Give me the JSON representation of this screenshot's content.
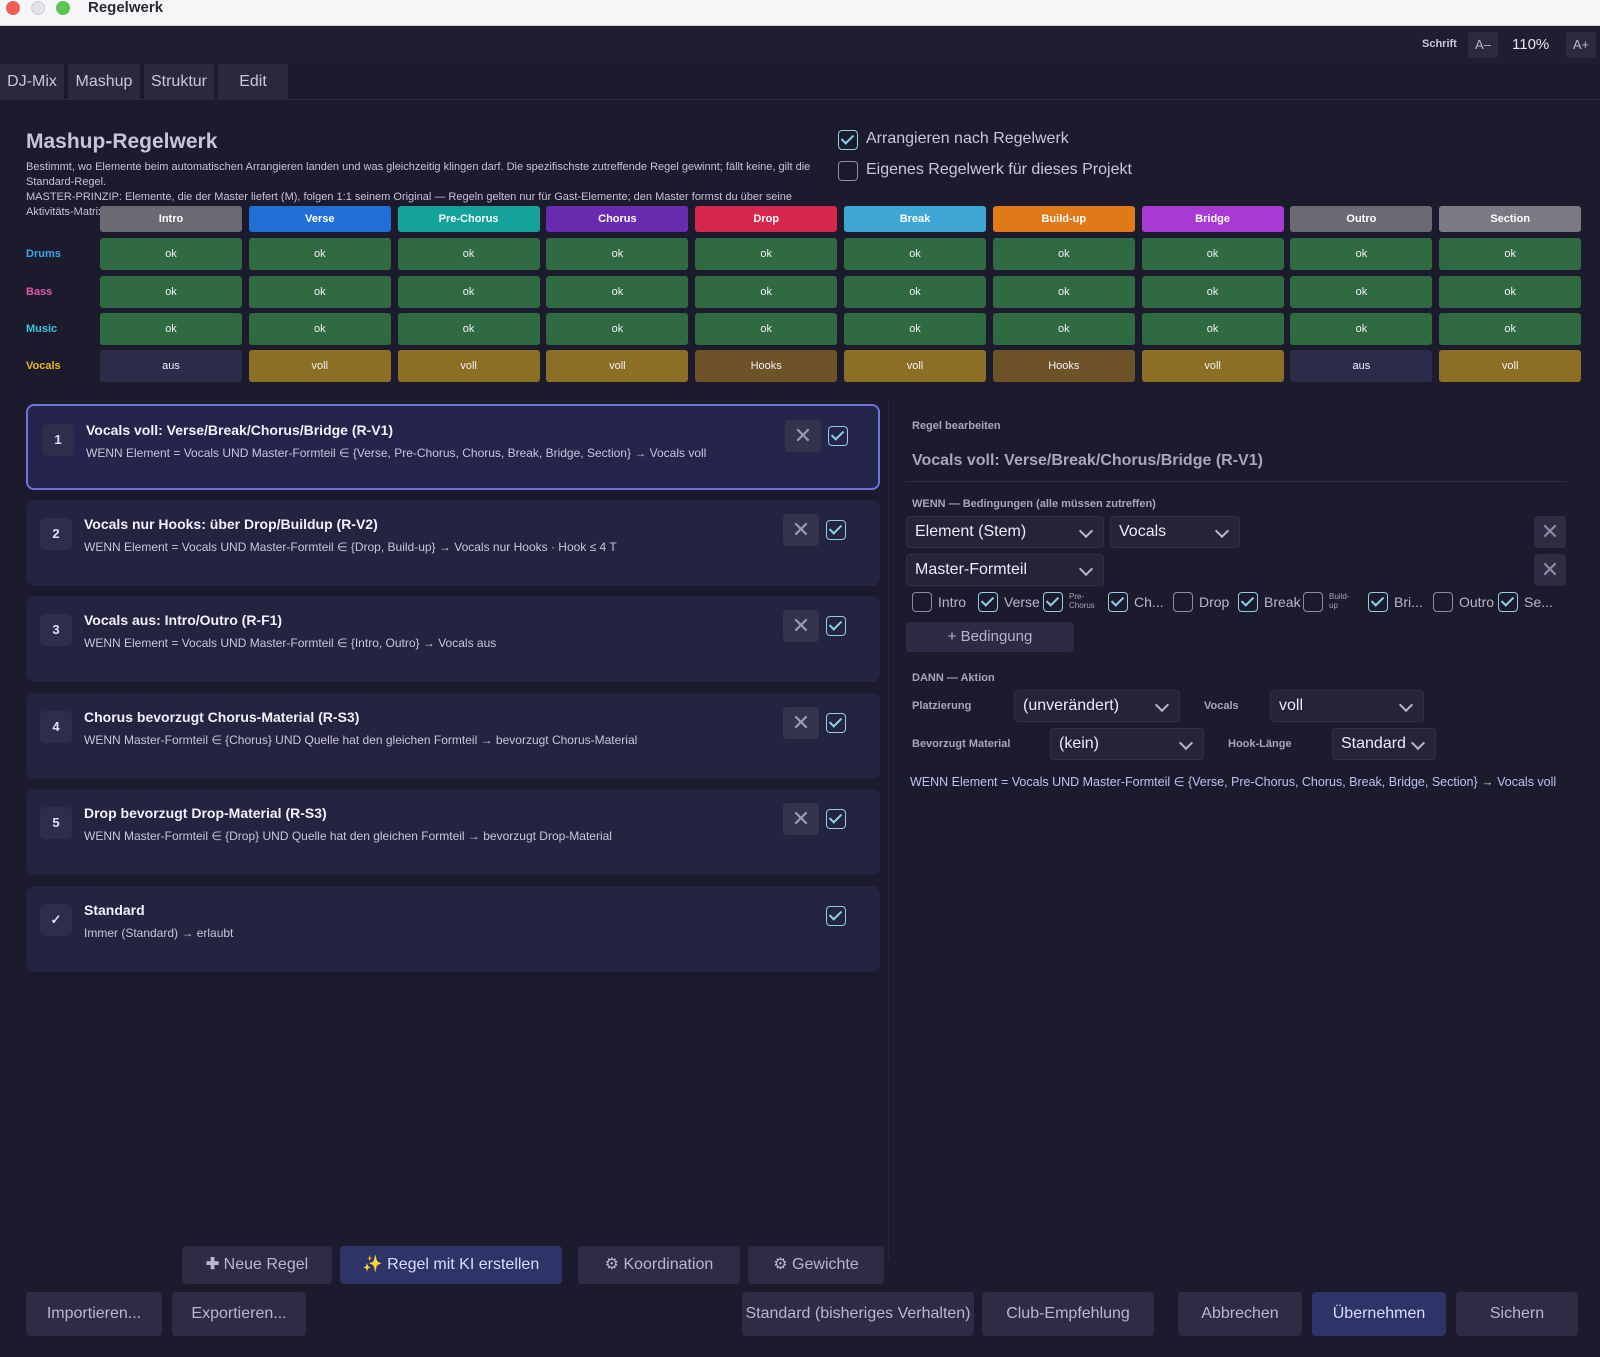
{
  "window": {
    "title": "Regelwerk"
  },
  "toolbar": {
    "font_label": "Schrift",
    "font_down": "A–",
    "zoom": "110%",
    "font_up": "A+"
  },
  "tabs": [
    {
      "label": "DJ-Mix"
    },
    {
      "label": "Mashup"
    },
    {
      "label": "Struktur"
    },
    {
      "label": "Edit"
    }
  ],
  "header": {
    "title": "Mashup-Regelwerk",
    "desc_line1": "Bestimmt, wo Elemente beim automatischen Arrangieren landen und was gleichzeitig klingen darf. Die spezifischste zutreffende Regel gewinnt; fällt keine, gilt die Standard-Regel.",
    "desc_line2": "MASTER-PRINZIP: Elemente, die der Master liefert (M), folgen 1:1 seinem Original — Regeln gelten nur für Gast-Elemente; den Master formst du über seine Aktivitäts-Matrix.",
    "opt_arrange": "Arrangieren nach Regelwerk",
    "opt_arrange_checked": true,
    "opt_own": "Eigenes Regelwerk für dieses Projekt",
    "opt_own_checked": false
  },
  "matrix": {
    "columns": [
      {
        "label": "Intro",
        "color": "#6a6a72"
      },
      {
        "label": "Verse",
        "color": "#1f6fd6"
      },
      {
        "label": "Pre-Chorus",
        "color": "#13a39a"
      },
      {
        "label": "Chorus",
        "color": "#6a2bb0"
      },
      {
        "label": "Drop",
        "color": "#d8274c"
      },
      {
        "label": "Break",
        "color": "#3fa7d6"
      },
      {
        "label": "Build-up",
        "color": "#e07a18"
      },
      {
        "label": "Bridge",
        "color": "#a83ad2"
      },
      {
        "label": "Outro",
        "color": "#6a6a72"
      },
      {
        "label": "Section",
        "color": "#7a7a82"
      }
    ],
    "rows": [
      {
        "label": "Drums",
        "color": "#3aa7e8",
        "cells": [
          "ok",
          "ok",
          "ok",
          "ok",
          "ok",
          "ok",
          "ok",
          "ok",
          "ok",
          "ok"
        ]
      },
      {
        "label": "Bass",
        "color": "#e05aa8",
        "cells": [
          "ok",
          "ok",
          "ok",
          "ok",
          "ok",
          "ok",
          "ok",
          "ok",
          "ok",
          "ok"
        ]
      },
      {
        "label": "Music",
        "color": "#3ac6d8",
        "cells": [
          "ok",
          "ok",
          "ok",
          "ok",
          "ok",
          "ok",
          "ok",
          "ok",
          "ok",
          "ok"
        ]
      },
      {
        "label": "Vocals",
        "color": "#e8b820",
        "cells": [
          "aus",
          "voll",
          "voll",
          "voll",
          "Hooks",
          "voll",
          "Hooks",
          "voll",
          "aus",
          "voll"
        ]
      }
    ]
  },
  "rules": [
    {
      "num": "1",
      "title": "Vocals voll: Verse/Break/Chorus/Bridge (R-V1)",
      "desc": "WENN Element = Vocals UND Master-Formteil ∈ {Verse, Pre-Chorus, Chorus, Break, Bridge, Section}  →  Vocals voll",
      "delete": "✕"
    },
    {
      "num": "2",
      "title": "Vocals nur Hooks: über Drop/Buildup (R-V2)",
      "desc": "WENN Element = Vocals UND Master-Formteil ∈ {Drop, Build-up}  →  Vocals nur Hooks · Hook ≤ 4 T",
      "delete": "✕"
    },
    {
      "num": "3",
      "title": "Vocals aus: Intro/Outro (R-F1)",
      "desc": "WENN Element = Vocals UND Master-Formteil ∈ {Intro, Outro}  →  Vocals aus",
      "delete": "✕"
    },
    {
      "num": "4",
      "title": "Chorus bevorzugt Chorus-Material (R-S3)",
      "desc": "WENN Master-Formteil ∈ {Chorus} UND Quelle hat den gleichen Formteil  →  bevorzugt Chorus-Material",
      "delete": "✕"
    },
    {
      "num": "5",
      "title": "Drop bevorzugt Drop-Material (R-S3)",
      "desc": "WENN Master-Formteil ∈ {Drop} UND Quelle hat den gleichen Formteil  →  bevorzugt Drop-Material",
      "delete": "✕"
    },
    {
      "num": "✓",
      "title": "Standard",
      "desc": "Immer (Standard) → erlaubt"
    }
  ],
  "editor": {
    "heading": "Regel bearbeiten",
    "name": "Vocals voll: Verse/Break/Chorus/Bridge (R-V1)",
    "when_label": "WENN — Bedingungen (alle müssen zutreffen)",
    "cond1_field": "Element (Stem)",
    "cond1_value": "Vocals",
    "cond2_field": "Master-Formteil",
    "remove": "✕",
    "section_checks": [
      {
        "label": "Intro",
        "checked": false
      },
      {
        "label": "Verse",
        "checked": true
      },
      {
        "label1": "Pre-",
        "label2": "Chorus",
        "checked": true
      },
      {
        "label": "Ch...",
        "checked": true
      },
      {
        "label": "Drop",
        "checked": false
      },
      {
        "label": "Break",
        "checked": true
      },
      {
        "label1": "Build-",
        "label2": "up",
        "checked": false
      },
      {
        "label": "Bri...",
        "checked": true
      },
      {
        "label": "Outro",
        "checked": false
      },
      {
        "label": "Se...",
        "checked": true
      }
    ],
    "add_condition": "+ Bedingung",
    "then_label": "DANN — Aktion",
    "placement_label": "Platzierung",
    "placement_value": "(unverändert)",
    "vocals_label": "Vocals",
    "vocals_value": "voll",
    "material_label": "Bevorzugt Material",
    "material_value": "(kein)",
    "hook_label": "Hook-Länge",
    "hook_value": "Standard",
    "summary": "WENN Element = Vocals UND Master-Formteil ∈ {Verse, Pre-Chorus, Chorus, Break, Bridge, Section}  →  Vocals voll"
  },
  "actions": {
    "new_rule": "Neue Regel",
    "ai_rule": "Regel mit KI erstellen",
    "coordination": "⚙ Koordination",
    "weights": "⚙ Gewichte",
    "import": "Importieren...",
    "export": "Exportieren...",
    "default": "Standard (bisheriges Verhalten)",
    "club": "Club-Empfehlung",
    "cancel": "Abbrechen",
    "apply": "Übernehmen",
    "save": "Sichern"
  }
}
